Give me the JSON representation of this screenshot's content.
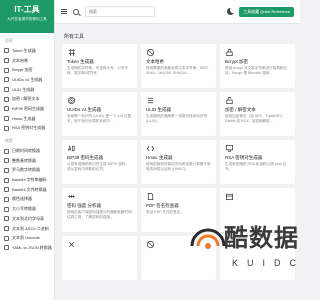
{
  "sidebar": {
    "brand_title": "IT-工具",
    "brand_sub": "为开发者提供的便利工具",
    "group_crypto": "加密",
    "crypto_items": [
      "Token 生成器",
      "文本哈希",
      "Bcrypt 加密",
      "UUIDs v4 生成器",
      "ULID 生成器",
      "加密 / 解密文本",
      "BIP39 密码生成器",
      "Hmac 生成器",
      "RSA 密钥对生成器"
    ],
    "crypto_tail": "密码 强度 分析器",
    "group_convert": "转换",
    "convert_items": [
      "日期时间转换器",
      "整数基转换器",
      "罗马数字转换器",
      "Base64 字符串编码",
      "Base64 文件转换器",
      "颜色选择器",
      "大小写转换器",
      "文本到北约字母表",
      "文本到 ASCII 二进制",
      "文本到 Unicode",
      "YAML to JSON 转换器"
    ]
  },
  "topbar": {
    "search_placeholder": "搜索",
    "quick_label": "工具收藏 Quick Reference"
  },
  "main": {
    "section_title": "所有工具",
    "cards": [
      {
        "icon": "token-icon",
        "title": "Token 生成器",
        "desc": "生成随机字符串，可选择大写、小写字母、数字和/或符号。"
      },
      {
        "icon": "hash-icon",
        "title": "文本哈希",
        "desc": "使用需要的函数哈希文本字符串：MD5, SHA1, SHA256, SHA224..."
      },
      {
        "icon": "lock-icon",
        "title": "Bcrypt 加密",
        "desc": "使用 bcrypt 对文本字符串进行哈希和比较，Bcrypt 是 Blowfish 密码..."
      },
      {
        "icon": "fingerprint-icon",
        "title": "UUIDs v4 生成器",
        "desc": "全局唯一标识符 (UUID) 是一个 128 位数字，用于标识计算机系统中..."
      },
      {
        "icon": "list-icon",
        "title": "ULID 生成器",
        "desc": "生成随机的通用唯一词典可排序标识符 (ULID)。"
      },
      {
        "icon": "lock-open-icon",
        "title": "加密 / 解密文本",
        "desc": "使用加密算法（如 AES、TripleDES、Rabbit 或 RC4）加密和解密..."
      },
      {
        "icon": "alphabet-icon",
        "title": "BIP39 密码生成器",
        "desc": "从现有或随机助记符生成 BIP39 密码，或从密码中获取助记符。"
      },
      {
        "icon": "code-icon",
        "title": "Hmac 生成器",
        "desc": "使用密钥和您喜欢的哈希函数计算基于哈希的消息认证码 (HMAC)。"
      },
      {
        "icon": "certificate-icon",
        "title": "RSA 密钥对生成器",
        "desc": "生成新的随机 RSA 私钥和公钥 pem 证书。"
      },
      {
        "icon": "password-icon",
        "title": "密码 强度 分析器",
        "desc": "使用此客户端密码强度分析器和破解时间估算工具，了解密码的强度。"
      },
      {
        "icon": "file-icon",
        "title": "PDF 签名检查器",
        "desc": "验证 PDF 文件的签名。"
      },
      {
        "icon": "calendar-icon",
        "title": "",
        "desc": ""
      },
      {
        "icon": "x-icon",
        "title": "",
        "desc": ""
      },
      {
        "icon": "hash-icon",
        "title": "",
        "desc": ""
      },
      {
        "icon": "text-icon",
        "title": "",
        "desc": ""
      }
    ]
  },
  "watermark": {
    "text": "酷数据",
    "sub": "KUIDC"
  },
  "colors": {
    "accent": "#1e9a66",
    "background": "#f1f2f4"
  }
}
